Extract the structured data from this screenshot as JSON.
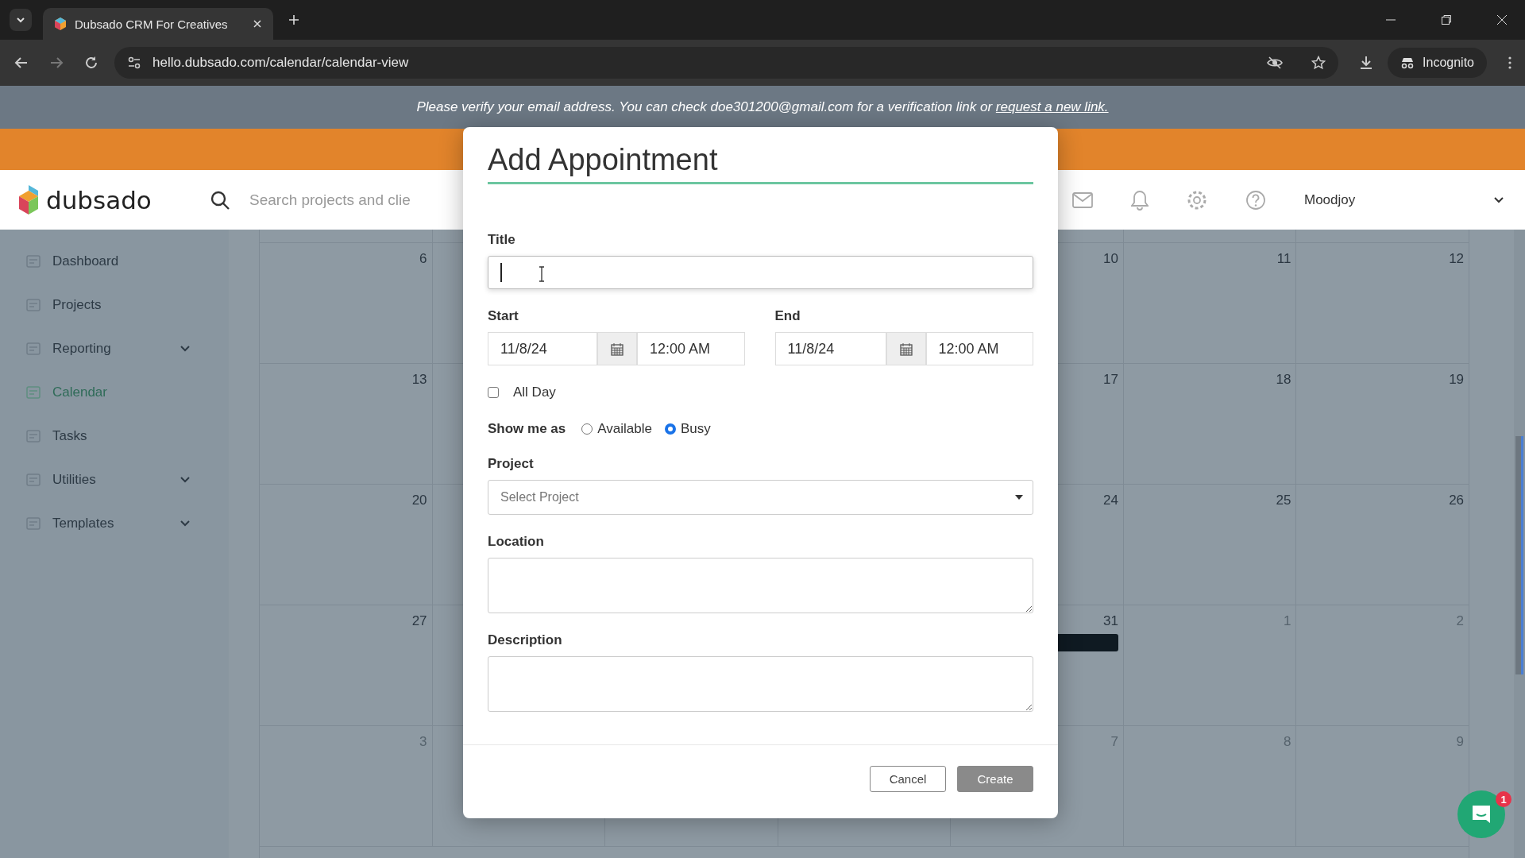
{
  "browser": {
    "tab_title": "Dubsado CRM For Creatives",
    "url": "hello.dubsado.com/calendar/calendar-view",
    "profile": "Incognito"
  },
  "verify_banner": {
    "text": "Please verify your email address. You can check doe301200@gmail.com for a verification link or",
    "link": "request a new link."
  },
  "header": {
    "logo": "dubsado",
    "search_placeholder": "Search projects and clie",
    "user": "Moodjoy"
  },
  "sidebar": {
    "items": [
      {
        "label": "Dashboard",
        "selected": false,
        "expandable": false
      },
      {
        "label": "Projects",
        "selected": false,
        "expandable": false
      },
      {
        "label": "Reporting",
        "selected": false,
        "expandable": true
      },
      {
        "label": "Calendar",
        "selected": true,
        "expandable": false
      },
      {
        "label": "Tasks",
        "selected": false,
        "expandable": false
      },
      {
        "label": "Utilities",
        "selected": false,
        "expandable": true
      },
      {
        "label": "Templates",
        "selected": false,
        "expandable": true
      }
    ]
  },
  "calendar": {
    "weeks": [
      {
        "left": [
          {
            "day": "6",
            "muted": false,
            "event": false
          }
        ],
        "right": [
          {
            "day": "10",
            "muted": false,
            "event": false
          },
          {
            "day": "11",
            "muted": false,
            "event": false
          },
          {
            "day": "12",
            "muted": false,
            "event": false
          }
        ]
      },
      {
        "left": [
          {
            "day": "13",
            "muted": false,
            "event": false
          }
        ],
        "right": [
          {
            "day": "17",
            "muted": false,
            "event": false
          },
          {
            "day": "18",
            "muted": false,
            "event": false
          },
          {
            "day": "19",
            "muted": false,
            "event": false
          }
        ]
      },
      {
        "left": [
          {
            "day": "20",
            "muted": false,
            "event": false
          }
        ],
        "right": [
          {
            "day": "24",
            "muted": false,
            "event": false
          },
          {
            "day": "25",
            "muted": false,
            "event": false
          },
          {
            "day": "26",
            "muted": false,
            "event": false
          }
        ]
      },
      {
        "left": [
          {
            "day": "27",
            "muted": false,
            "event": false
          }
        ],
        "right": [
          {
            "day": "31",
            "muted": false,
            "event": true
          },
          {
            "day": "1",
            "muted": true,
            "event": false
          },
          {
            "day": "2",
            "muted": true,
            "event": false
          }
        ]
      },
      {
        "left": [
          {
            "day": "3",
            "muted": true,
            "event": false
          }
        ],
        "right": [
          {
            "day": "7",
            "muted": true,
            "event": false
          },
          {
            "day": "8",
            "muted": true,
            "event": false
          },
          {
            "day": "9",
            "muted": true,
            "event": false
          }
        ]
      }
    ]
  },
  "dialog": {
    "title": "Add Appointment",
    "title_field": {
      "label": "Title",
      "focused": true
    },
    "start": {
      "label": "Start",
      "date": "11/8/24",
      "time": "12:00 AM"
    },
    "end": {
      "label": "End",
      "date": "11/8/24",
      "time": "12:00 AM"
    },
    "all_day": {
      "label": "All Day",
      "checked": false
    },
    "show_me_as": {
      "label": "Show me as",
      "options": [
        {
          "label": "Available",
          "selected": false
        },
        {
          "label": "Busy",
          "selected": true
        }
      ]
    },
    "project": {
      "label": "Project",
      "placeholder": "Select Project"
    },
    "location": {
      "label": "Location"
    },
    "description": {
      "label": "Description"
    },
    "buttons": [
      {
        "label": "Cancel",
        "kind": "secondary"
      },
      {
        "label": "Create",
        "kind": "primary"
      }
    ]
  },
  "chat": {
    "badge": "1"
  }
}
